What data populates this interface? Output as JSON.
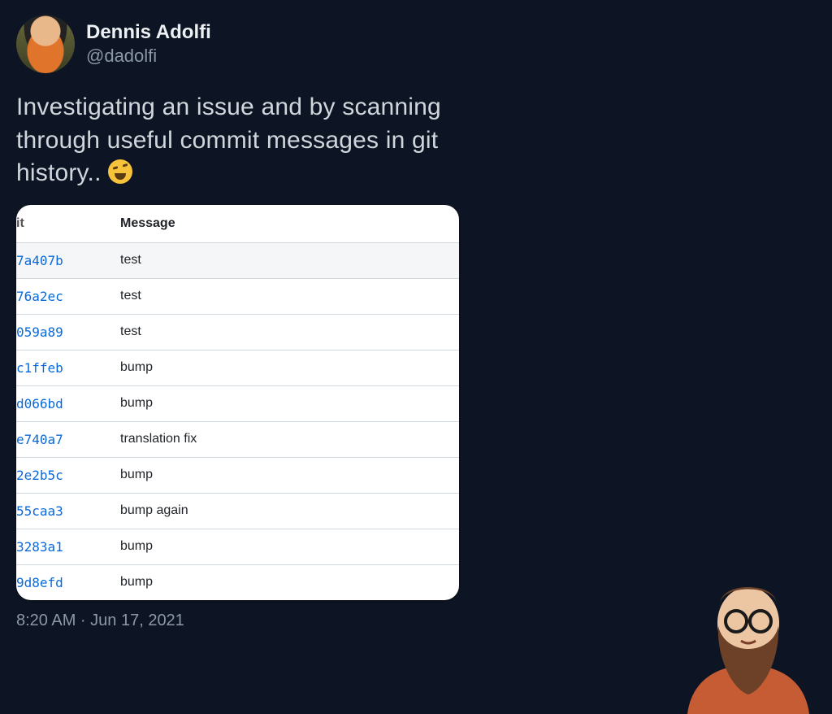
{
  "tweet": {
    "author": {
      "display_name": "Dennis Adolfi",
      "handle": "@dadolfi"
    },
    "text": "Investigating an issue and by scanning through useful commit messages in git history..",
    "emoji_name": "tired-face",
    "timestamp": "8:20 AM · Jun 17, 2021"
  },
  "commits": {
    "columns": {
      "hash": "it",
      "message": "Message"
    },
    "rows": [
      {
        "hash": "7a407b",
        "message": "test"
      },
      {
        "hash": "76a2ec",
        "message": "test"
      },
      {
        "hash": "059a89",
        "message": "test"
      },
      {
        "hash": "c1ffeb",
        "message": "bump"
      },
      {
        "hash": "d066bd",
        "message": "bump"
      },
      {
        "hash": "e740a7",
        "message": "translation fix"
      },
      {
        "hash": "2e2b5c",
        "message": "bump"
      },
      {
        "hash": "55caa3",
        "message": "bump again"
      },
      {
        "hash": "3283a1",
        "message": "bump"
      },
      {
        "hash": "9d8efd",
        "message": "bump"
      }
    ]
  }
}
